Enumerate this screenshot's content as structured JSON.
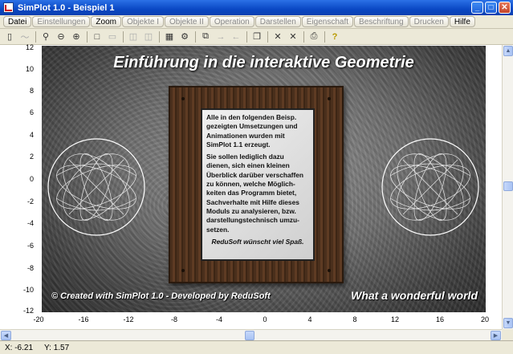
{
  "window": {
    "title": "SimPlot 1.0 - Beispiel 1"
  },
  "menu": [
    {
      "label": "Datei",
      "enabled": true
    },
    {
      "label": "Einstellungen",
      "enabled": false
    },
    {
      "label": "Zoom",
      "enabled": true
    },
    {
      "label": "Objekte I",
      "enabled": false
    },
    {
      "label": "Objekte II",
      "enabled": false
    },
    {
      "label": "Operation",
      "enabled": false
    },
    {
      "label": "Darstellen",
      "enabled": false
    },
    {
      "label": "Eigenschaft",
      "enabled": false
    },
    {
      "label": "Beschriftung",
      "enabled": false
    },
    {
      "label": "Drucken",
      "enabled": false
    },
    {
      "label": "Hilfe",
      "enabled": true
    }
  ],
  "axes": {
    "y_ticks": [
      "12",
      "10",
      "8",
      "6",
      "4",
      "2",
      "0",
      "-2",
      "-4",
      "-6",
      "-8",
      "-10",
      "-12"
    ],
    "x_ticks": [
      "-20",
      "-16",
      "-12",
      "-8",
      "-4",
      "0",
      "4",
      "8",
      "12",
      "16",
      "20"
    ]
  },
  "image": {
    "headline": "Einführung in die interaktive Geometrie",
    "paragraph1": "Alle in den folgenden Beisp. gezeigten Umsetzungen und Animationen wurden mit SimPlot 1.1 erzeugt.",
    "paragraph2": "Sie sollen lediglich dazu dienen, sich einen kleinen Überblick darüber verschaffen zu können, welche Möglich-keiten das Programm bietet, Sachverhalte mit Hilfe dieses Moduls zu analysieren, bzw. darstellungstechnisch umzu-setzen.",
    "signature": "ReduSoft wünscht viel Spaß.",
    "footer_left": "© Created with SimPlot 1.0 - Developed by ReduSoft",
    "footer_right": "What a wonderful world"
  },
  "status": {
    "x": "X: -6.21",
    "y": "Y: 1.57"
  }
}
